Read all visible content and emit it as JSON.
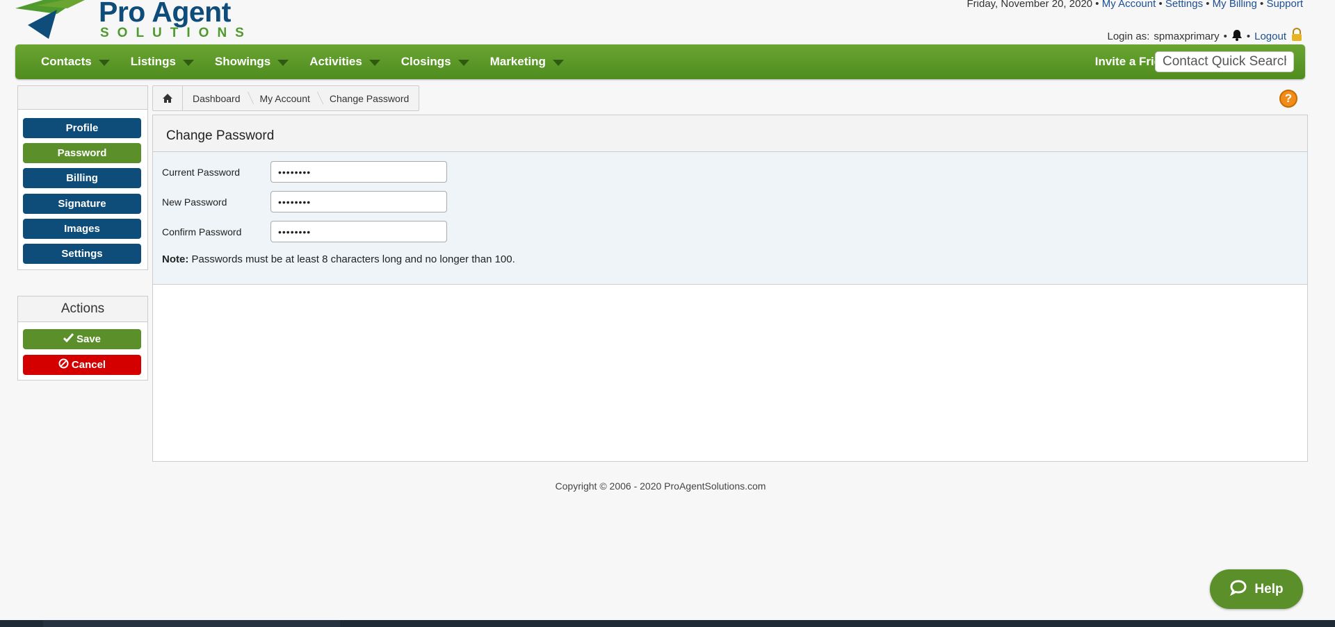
{
  "header": {
    "logo_line1": "Pro Agent",
    "logo_line2": "SOLUTIONS",
    "date": "Friday, November 20, 2020",
    "links": [
      "My Account",
      "Settings",
      "My Billing",
      "Support"
    ],
    "login_prefix": "Login as:",
    "username": "spmaxprimary",
    "logout": "Logout"
  },
  "nav": {
    "items": [
      "Contacts",
      "Listings",
      "Showings",
      "Activities",
      "Closings",
      "Marketing"
    ],
    "invite": "Invite a Friend",
    "search_placeholder": "Contact Quick Search"
  },
  "sidebar": {
    "items": [
      "Profile",
      "Password",
      "Billing",
      "Signature",
      "Images",
      "Settings"
    ],
    "active": "Password"
  },
  "actions": {
    "title": "Actions",
    "save": "Save",
    "cancel": "Cancel"
  },
  "breadcrumb": [
    "Dashboard",
    "My Account",
    "Change Password"
  ],
  "form": {
    "title": "Change Password",
    "fields": [
      {
        "label": "Current Password",
        "value": "••••••••"
      },
      {
        "label": "New Password",
        "value": "••••••••"
      },
      {
        "label": "Confirm Password",
        "value": "••••••••"
      }
    ],
    "note_label": "Note:",
    "note_text": "Passwords must be at least 8 characters long and no longer than 100."
  },
  "footer": {
    "copyright": "Copyright © 2006 - 2020 ProAgentSolutions.com"
  },
  "help_chat": "Help",
  "colors": {
    "brand_blue": "#0e4d7a",
    "brand_green": "#5b8f2a",
    "cancel_red": "#d40000"
  }
}
